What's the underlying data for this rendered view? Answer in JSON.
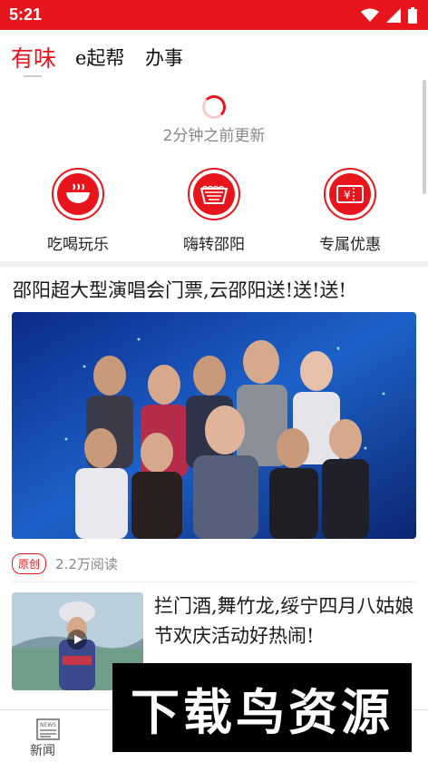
{
  "status_bar": {
    "time": "5:21"
  },
  "top_tabs": [
    {
      "label": "有味",
      "active": true
    },
    {
      "label": "e起帮"
    },
    {
      "label": "办事"
    }
  ],
  "refresh": {
    "text": "2分钟之前更新"
  },
  "quick_entries": [
    {
      "label": "吃喝玩乐",
      "icon": "bowl-icon"
    },
    {
      "label": "嗨转邵阳",
      "icon": "basket-icon"
    },
    {
      "label": "专属优惠",
      "icon": "ticket-icon"
    }
  ],
  "headline": {
    "title": "邵阳超大型演唱会门票,云邵阳送!送!送!",
    "tag": "原创",
    "reads": "2.2万阅读"
  },
  "article2": {
    "title": "拦门酒,舞竹龙,绥宁四月八姑娘节欢庆活动好热闹!"
  },
  "bottom_nav": [
    {
      "label": "新闻",
      "icon": "news-icon"
    },
    {
      "label": "",
      "icon": "tab2-icon"
    },
    {
      "label": "",
      "icon": "tab3-icon"
    },
    {
      "label": "",
      "icon": "tab4-icon"
    },
    {
      "label": "",
      "icon": "tab5-icon"
    }
  ],
  "watermark": {
    "text": "下载鸟资源"
  },
  "colors": {
    "brand": "#e8161c"
  }
}
